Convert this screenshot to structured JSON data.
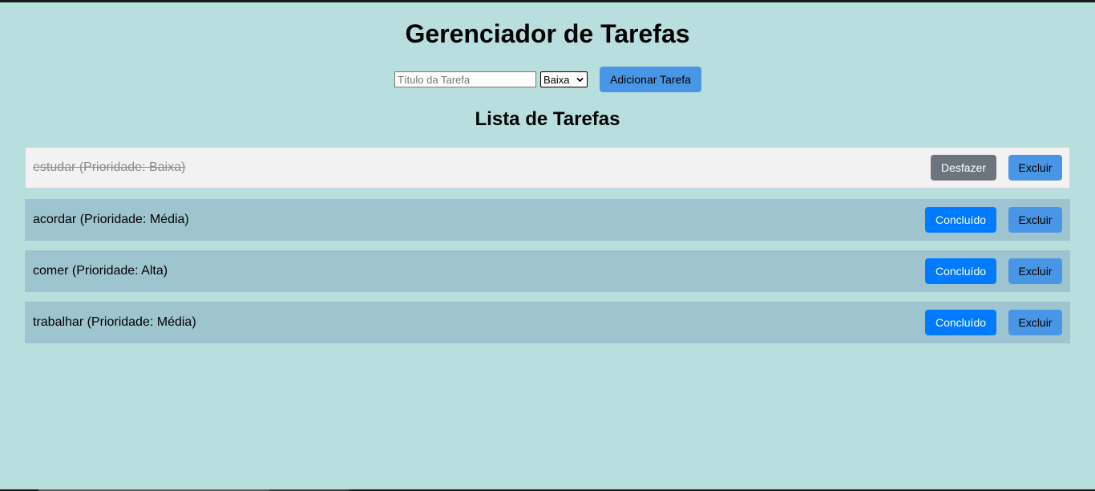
{
  "header": {
    "title": "Gerenciador de Tarefas"
  },
  "form": {
    "title_placeholder": "Título da Tarefa",
    "title_value": "",
    "priority_selected": "Baixa",
    "add_label": "Adicionar Tarefa"
  },
  "list": {
    "title": "Lista de Tarefas",
    "tasks": [
      {
        "text": "estudar (Prioridade: Baixa)",
        "completed": true,
        "toggle_label": "Desfazer",
        "delete_label": "Excluir"
      },
      {
        "text": "acordar (Prioridade: Média)",
        "completed": false,
        "toggle_label": "Concluído",
        "delete_label": "Excluir"
      },
      {
        "text": "comer (Prioridade: Alta)",
        "completed": false,
        "toggle_label": "Concluído",
        "delete_label": "Excluir"
      },
      {
        "text": "trabalhar (Prioridade: Média)",
        "completed": false,
        "toggle_label": "Concluído",
        "delete_label": "Excluir"
      }
    ]
  },
  "colors": {
    "background": "#b9dede",
    "task_row": "#9ec5cf",
    "task_row_done": "#f2f2f2",
    "primary_button": "#007bff",
    "secondary_button": "#6c757d",
    "accent_button": "#4a96e6"
  }
}
